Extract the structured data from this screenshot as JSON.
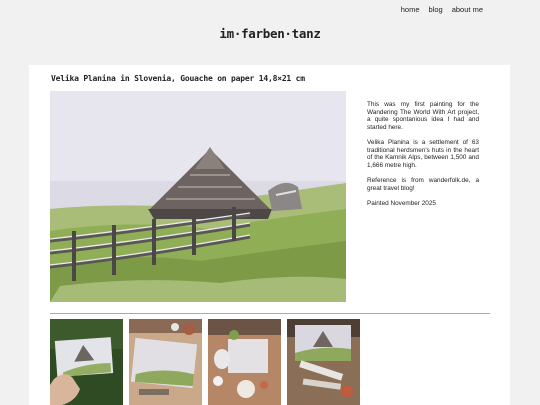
{
  "nav": {
    "items": [
      "home",
      "blog",
      "about me"
    ]
  },
  "site": {
    "title": "im·farben·tanz"
  },
  "post": {
    "title": "Velika Planina in Slovenia, Gouache on paper 14,8×21 cm",
    "paragraphs": [
      "This was my first painting for the Wandering The World With Art project, a quite spontanious idea I had and started here.",
      "Velika Planina is a settlement of 63 traditional herdsmen's huts in the heart of the Kamnik Alps, between 1,500 and 1,666 metre high.",
      "Reference is from wanderfolk.de, a great travel blog!",
      "Painted November 2025"
    ]
  },
  "colors": {
    "background": "#f1f1f1",
    "card": "#ffffff",
    "text": "#222222",
    "divider": "#aaaaaa"
  }
}
